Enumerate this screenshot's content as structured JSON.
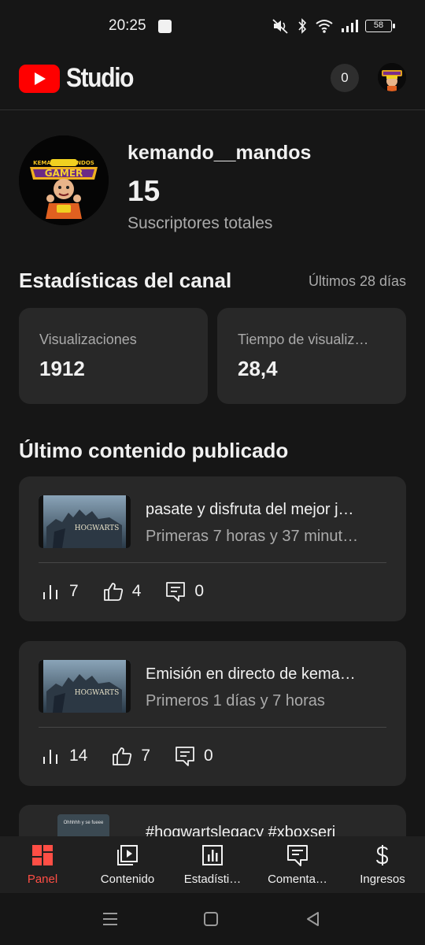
{
  "status_bar": {
    "time": "20:25",
    "battery": "58"
  },
  "app_bar": {
    "logo_text": "Studio",
    "notification_count": "0"
  },
  "channel": {
    "name": "kemando__mandos",
    "subscriber_count": "15",
    "subscriber_label": "Suscriptores totales",
    "avatar_text_top": "KEMANDO MANDOS",
    "avatar_text_main": "GAMER"
  },
  "stats": {
    "title": "Estadísticas del canal",
    "range": "Últimos 28 días",
    "cards": [
      {
        "label": "Visualizaciones",
        "value": "1912"
      },
      {
        "label": "Tiempo de visualiz…",
        "value": "28,4"
      }
    ]
  },
  "latest": {
    "title": "Último contenido publicado",
    "videos": [
      {
        "title": "pasate y disfruta del mejor j…",
        "subtitle": "Primeras 7 horas y 37 minut…",
        "thumb_text": "HOGWARTS",
        "views": "7",
        "likes": "4",
        "comments": "0"
      },
      {
        "title": "Emisión en directo de kema…",
        "subtitle": "Primeros 1 días y 7 horas",
        "thumb_text": "HOGWARTS",
        "views": "14",
        "likes": "7",
        "comments": "0"
      }
    ],
    "partial": {
      "title": "#hogwartslegacy #xboxseri",
      "thumb_text": "Ohhhhh y se fueee"
    }
  },
  "bottom_nav": [
    {
      "label": "Panel",
      "icon": "dashboard-icon",
      "active": true
    },
    {
      "label": "Contenido",
      "icon": "content-icon",
      "active": false
    },
    {
      "label": "Estadísti…",
      "icon": "analytics-icon",
      "active": false
    },
    {
      "label": "Comenta…",
      "icon": "comments-icon",
      "active": false
    },
    {
      "label": "Ingresos",
      "icon": "earn-icon",
      "active": false
    }
  ],
  "colors": {
    "background": "#161616",
    "card": "#282828",
    "accent": "#ff4e45",
    "youtube_red": "#ff0000",
    "secondary_text": "#aaaaaa"
  }
}
